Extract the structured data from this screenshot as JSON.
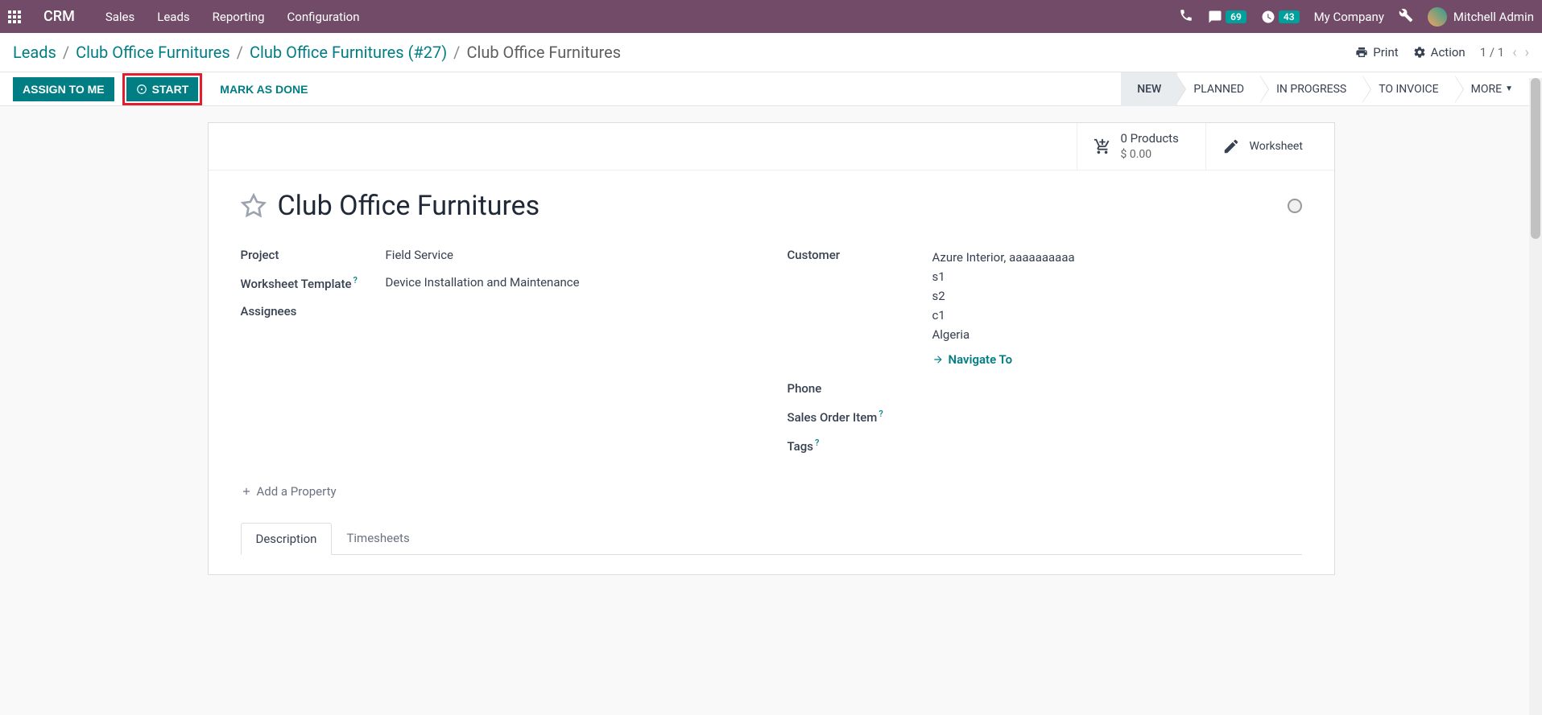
{
  "navbar": {
    "brand": "CRM",
    "menu": [
      "Sales",
      "Leads",
      "Reporting",
      "Configuration"
    ],
    "messages_badge": "69",
    "activities_badge": "43",
    "company": "My Company",
    "user": "Mitchell Admin"
  },
  "breadcrumb": {
    "items": [
      "Leads",
      "Club Office Furnitures",
      "Club Office Furnitures (#27)"
    ],
    "current": "Club Office Furnitures"
  },
  "cp_actions": {
    "print": "Print",
    "action": "Action",
    "pager": "1 / 1"
  },
  "statusbar": {
    "assign": "ASSIGN TO ME",
    "start": "START",
    "done": "MARK AS DONE",
    "steps": [
      "NEW",
      "PLANNED",
      "IN PROGRESS",
      "TO INVOICE"
    ],
    "more": "MORE"
  },
  "stat_buttons": {
    "products": {
      "line1": "0 Products",
      "line2": "$ 0.00"
    },
    "worksheet": "Worksheet"
  },
  "record": {
    "title": "Club Office Furnitures",
    "fields": {
      "project_label": "Project",
      "project_value": "Field Service",
      "worksheet_template_label": "Worksheet Template",
      "worksheet_template_value": "Device Installation and Maintenance",
      "assignees_label": "Assignees",
      "customer_label": "Customer",
      "customer_value": "Azure Interior, aaaaaaaaaa",
      "addr": [
        "s1",
        "s2",
        "c1",
        "Algeria"
      ],
      "navigate": "Navigate To",
      "phone_label": "Phone",
      "soi_label": "Sales Order Item",
      "tags_label": "Tags"
    },
    "add_property": "Add a Property",
    "tabs": [
      "Description",
      "Timesheets"
    ]
  }
}
